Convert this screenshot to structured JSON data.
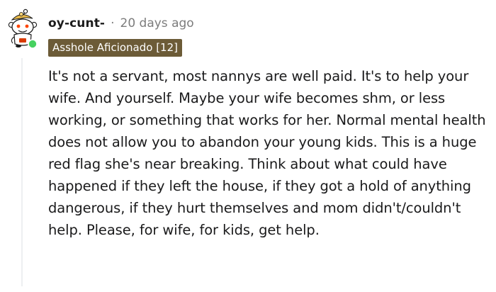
{
  "comment": {
    "username": "oy-cunt-",
    "separator": "·",
    "timestamp": "20 days ago",
    "flair": "Asshole Aficionado [12]",
    "body": "It's not a servant, most nannys are well paid. It's to help your wife. And yourself. Maybe your wife becomes shm, or less working, or something that works for her. Normal mental health does not allow you to abandon your young kids. This is a huge red flag she's near breaking. Think about what could have happened if they left the house, if they got a hold of anything dangerous, if they hurt themselves and mom didn't/couldn't help. Please, for wife, for kids, get help."
  },
  "colors": {
    "flair_background": "#6c5b37",
    "online_indicator": "#46d160",
    "timestamp": "#7c7c7c",
    "thread_line": "#edeff1"
  },
  "icons": {
    "avatar": "snoo-avatar-icon",
    "online": "online-status-icon"
  }
}
